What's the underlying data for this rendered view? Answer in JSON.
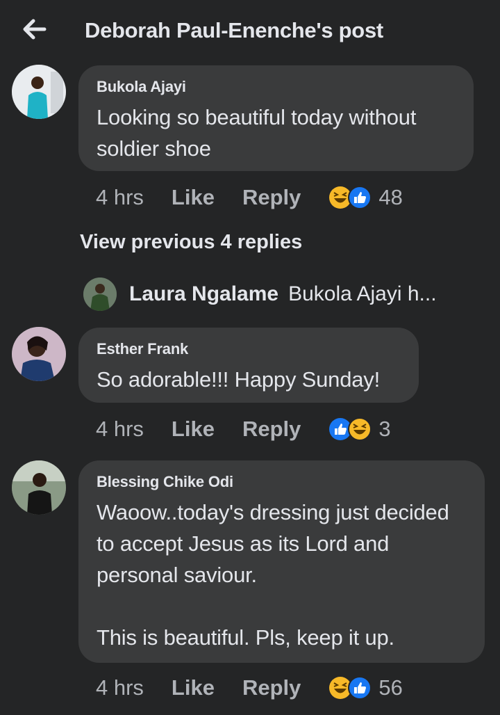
{
  "header": {
    "title": "Deborah Paul-Enenche's post",
    "back_icon": "arrow-left-icon"
  },
  "comments": [
    {
      "author": "Bukola Ajayi",
      "text": "Looking so beautiful today without soldier shoe",
      "time": "4 hrs",
      "like_label": "Like",
      "reply_label": "Reply",
      "reactions": [
        "haha-icon",
        "like-icon"
      ],
      "reaction_count": "48"
    },
    {
      "author": "Esther Frank",
      "text": "So adorable!!! Happy Sunday!",
      "time": "4 hrs",
      "like_label": "Like",
      "reply_label": "Reply",
      "reactions": [
        "like-icon",
        "haha-icon"
      ],
      "reaction_count": "3"
    },
    {
      "author": "Blessing Chike Odi",
      "text": "Waoow..today's dressing just decided to accept Jesus as its Lord and personal saviour.\n\nThis is beautiful. Pls, keep it up.",
      "time": "4 hrs",
      "like_label": "Like",
      "reply_label": "Reply",
      "reactions": [
        "haha-icon",
        "like-icon"
      ],
      "reaction_count": "56"
    }
  ],
  "replies": {
    "view_previous_label": "View previous 4 replies",
    "latest": {
      "author": "Laura Ngalame",
      "snippet": "Bukola Ajayi h..."
    }
  },
  "colors": {
    "background": "#242526",
    "bubble": "#3a3b3c",
    "primary_text": "#e4e6eb",
    "secondary_text": "#b0b3b8",
    "like_blue": "#1877f2",
    "haha_yellow": "#f7b928"
  }
}
